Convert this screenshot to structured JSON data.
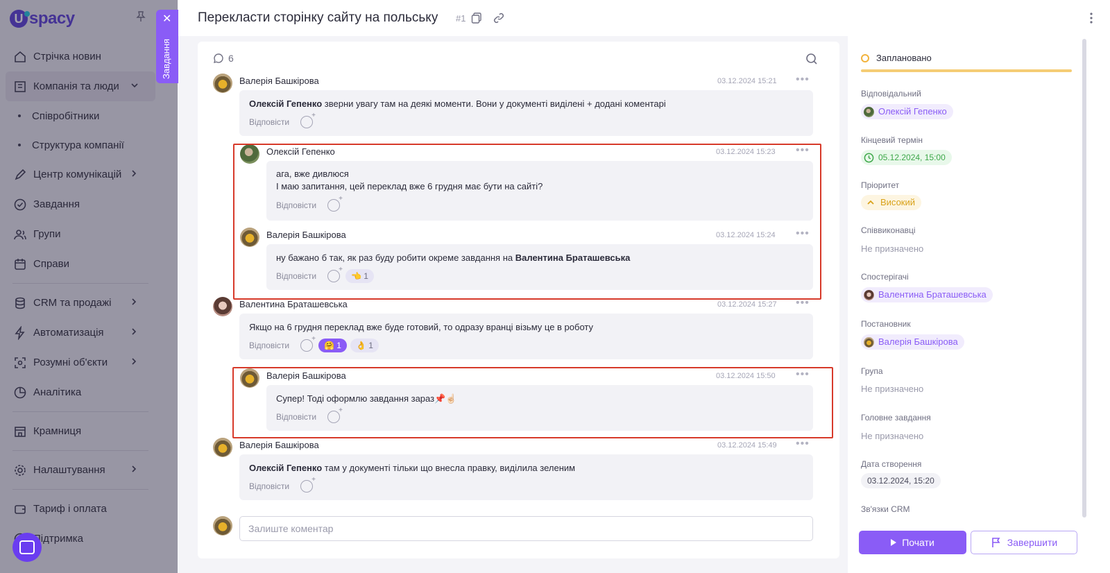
{
  "sidebar": {
    "logo_letter": "U",
    "logo_text": "spacy",
    "items": [
      {
        "label": "Стрічка новин"
      },
      {
        "label": "Компанія та люди"
      },
      {
        "label": "Співробітники"
      },
      {
        "label": "Структура компанії"
      },
      {
        "label": "Центр комунікацій"
      },
      {
        "label": "Завдання"
      },
      {
        "label": "Групи"
      },
      {
        "label": "Справи"
      },
      {
        "label": "CRM та продажі"
      },
      {
        "label": "Автоматизація"
      },
      {
        "label": "Розумні об'єкти"
      },
      {
        "label": "Аналітика"
      },
      {
        "label": "Крамниця"
      },
      {
        "label": "Налаштування"
      },
      {
        "label": "Тариф і оплата"
      },
      {
        "label": "Підтримка"
      }
    ],
    "task_tab_label": "Завдання"
  },
  "header": {
    "title": "Перекласти сторінку сайту на польську",
    "number": "#1"
  },
  "comments_panel": {
    "count": "6",
    "reply_label": "Відповісти",
    "input_placeholder": "Залиште коментар",
    "comments": [
      {
        "author": "Валерія Башкірова",
        "date": "03.12.2024 15:21",
        "mention": "Олексій Гепенко",
        "text": " зверни увагу там на деякі моменти. Вони у документі виділені + додані коментарі"
      },
      {
        "author": "Олексій Гепенко",
        "date": "03.12.2024 15:23",
        "line1": " ага, вже дивлюся",
        "line2": "І маю запитання, цей переклад вже 6 грудня має бути на сайті?"
      },
      {
        "author": "Валерія Башкірова",
        "date": "03.12.2024 15:24",
        "text": "ну бажано б так, як раз буду робити окреме завдання на ",
        "mention": "Валентина Браташевська",
        "reaction1": "👈 1"
      },
      {
        "author": "Валентина Браташевська",
        "date": "03.12.2024 15:27",
        "text": "Якщо на 6 грудня переклад вже буде готовий, то одразу вранці візьму це в роботу",
        "reaction1": "🤗 1",
        "reaction2": "👌 1"
      },
      {
        "author": "Валерія Башкірова",
        "date": "03.12.2024 15:50",
        "text": "Супер! Тоді оформлю завдання зараз📌☝🏻"
      },
      {
        "author": "Валерія Башкірова",
        "date": "03.12.2024 15:49",
        "mention": "Олексій Гепенко",
        "text": " там у документі тільки що внесла правку, виділила зеленим"
      }
    ]
  },
  "details": {
    "status": "Заплановано",
    "responsible_label": "Відповідальний",
    "responsible": "Олексій Гепенко",
    "deadline_label": "Кінцевий термін",
    "deadline": "05.12.2024, 15:00",
    "priority_label": "Пріоритет",
    "priority": "Високий",
    "coexecutors_label": "Співвиконавці",
    "not_assigned": "Не призначено",
    "observers_label": "Спостерігачі",
    "observer": "Валентина Браташевська",
    "creator_label": "Постановник",
    "creator": "Валерія Башкірова",
    "group_label": "Група",
    "parent_label": "Головне завдання",
    "created_label": "Дата створення",
    "created": "03.12.2024, 15:20",
    "crm_label": "Зв'язки CRM",
    "start_button": "Почати",
    "finish_button": "Завершити"
  },
  "colors": {
    "accent": "#8a5cf6",
    "highlight_border": "#d73a2a",
    "status_bar": "#f5cd75"
  }
}
